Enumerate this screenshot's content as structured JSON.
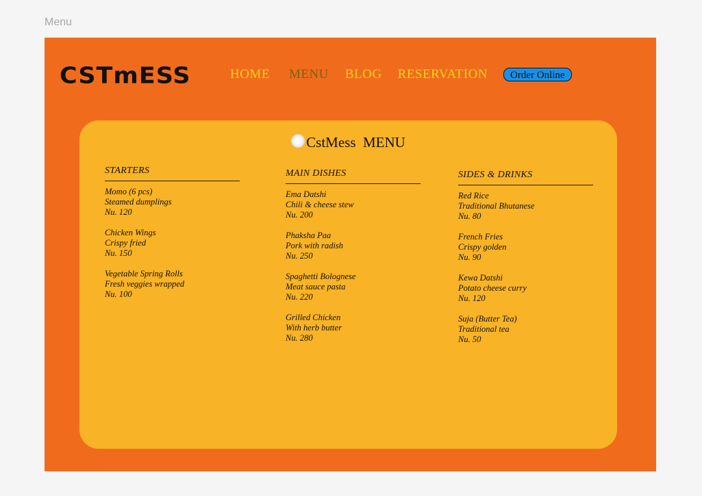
{
  "frame": {
    "label": "Menu"
  },
  "header": {
    "logo": "CSTmESS",
    "nav": [
      "HOME",
      "MENU",
      "BLOG",
      "RESERVATION"
    ],
    "order_button": "Order Online"
  },
  "menu": {
    "title": "CstMess  MENU",
    "columns": [
      {
        "heading": "STARTERS",
        "items": [
          {
            "name": "Momo (6 pcs)",
            "desc": "Steamed dumplings",
            "price": "Nu. 120"
          },
          {
            "name": "Chicken Wings",
            "desc": "Crispy fried",
            "price": "Nu. 150"
          },
          {
            "name": "Vegetable Spring Rolls",
            "desc": "Fresh veggies wrapped",
            "price": "Nu. 100"
          }
        ]
      },
      {
        "heading": "MAIN DISHES",
        "items": [
          {
            "name": "Ema Datshi",
            "desc": "Chili & cheese stew",
            "price": "Nu. 200"
          },
          {
            "name": "Phaksha Paa",
            "desc": "Pork with radish",
            "price": "Nu. 250"
          },
          {
            "name": "Spaghetti Bolognese",
            "desc": "Meat sauce pasta",
            "price": "Nu. 220"
          },
          {
            "name": "Grilled Chicken",
            "desc": "With herb butter",
            "price": "Nu. 280"
          }
        ]
      },
      {
        "heading": "SIDES & DRINKS",
        "items": [
          {
            "name": "Red Rice",
            "desc": "Traditional Bhutanese",
            "price": "Nu. 80"
          },
          {
            "name": "French Fries",
            "desc": "Crispy golden",
            "price": "Nu. 90"
          },
          {
            "name": "Kewa Datshi",
            "desc": "Potato cheese curry",
            "price": "Nu. 120"
          },
          {
            "name": "Suja (Butter Tea)",
            "desc": "Traditional tea",
            "price": "Nu. 50"
          }
        ]
      }
    ]
  },
  "colors": {
    "background": "#f06c1c",
    "card": "#f8b326",
    "nav_text": "#f8d41a",
    "nav_active": "#7a6313",
    "order_button": "#1890e8"
  },
  "icons": {
    "title_icon": "plate-icon"
  }
}
